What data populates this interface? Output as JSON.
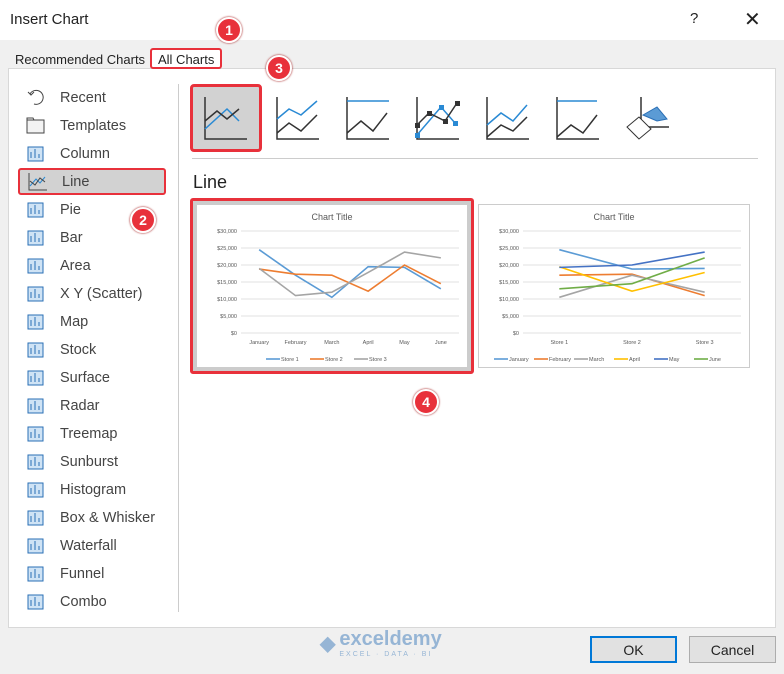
{
  "window": {
    "title": "Insert Chart",
    "help": "?",
    "close": "✕"
  },
  "tabs": [
    {
      "label": "Recommended Charts"
    },
    {
      "label": "All Charts",
      "selected": true
    }
  ],
  "sidebar": {
    "items": [
      {
        "label": "Recent",
        "icon": "recent-icon"
      },
      {
        "label": "Templates",
        "icon": "folder-icon"
      },
      {
        "label": "Column",
        "icon": "column-chart-icon"
      },
      {
        "label": "Line",
        "icon": "line-chart-icon",
        "selected": true
      },
      {
        "label": "Pie",
        "icon": "pie-chart-icon"
      },
      {
        "label": "Bar",
        "icon": "bar-chart-icon"
      },
      {
        "label": "Area",
        "icon": "area-chart-icon"
      },
      {
        "label": "X Y (Scatter)",
        "icon": "scatter-chart-icon"
      },
      {
        "label": "Map",
        "icon": "map-chart-icon"
      },
      {
        "label": "Stock",
        "icon": "stock-chart-icon"
      },
      {
        "label": "Surface",
        "icon": "surface-chart-icon"
      },
      {
        "label": "Radar",
        "icon": "radar-chart-icon"
      },
      {
        "label": "Treemap",
        "icon": "treemap-chart-icon"
      },
      {
        "label": "Sunburst",
        "icon": "sunburst-chart-icon"
      },
      {
        "label": "Histogram",
        "icon": "histogram-chart-icon"
      },
      {
        "label": "Box & Whisker",
        "icon": "box-whisker-chart-icon"
      },
      {
        "label": "Waterfall",
        "icon": "waterfall-chart-icon"
      },
      {
        "label": "Funnel",
        "icon": "funnel-chart-icon"
      },
      {
        "label": "Combo",
        "icon": "combo-chart-icon"
      }
    ]
  },
  "subtypes": [
    "Line",
    "Stacked Line",
    "100% Stacked Line",
    "Line with Markers",
    "Stacked Line with Markers",
    "100% Stacked Line with Markers",
    "3-D Line"
  ],
  "main": {
    "heading": "Line"
  },
  "colors": {
    "accent": "#e8313b",
    "series": [
      "#5b9bd5",
      "#ed7d31",
      "#a5a5a5",
      "#ffc000",
      "#4472c4",
      "#70ad47"
    ]
  },
  "chart_data": [
    {
      "type": "line",
      "title": "Chart Title",
      "categories": [
        "January",
        "February",
        "March",
        "April",
        "May",
        "June"
      ],
      "ylim": [
        0,
        30000
      ],
      "yticks": [
        "$0",
        "$5,000",
        "$10,000",
        "$15,000",
        "$20,000",
        "$25,000",
        "$30,000"
      ],
      "legend": "bottom",
      "grid": true,
      "series": [
        {
          "name": "Store 1",
          "values": [
            24500,
            17000,
            10500,
            19500,
            19300,
            13000
          ]
        },
        {
          "name": "Store 2",
          "values": [
            18800,
            17300,
            17000,
            12300,
            20000,
            14500
          ]
        },
        {
          "name": "Store 3",
          "values": [
            19000,
            11000,
            12000,
            17800,
            23800,
            22100
          ]
        }
      ]
    },
    {
      "type": "line",
      "title": "Chart Title",
      "categories": [
        "Store 1",
        "Store 2",
        "Store 3"
      ],
      "ylim": [
        0,
        30000
      ],
      "yticks": [
        "$0",
        "$5,000",
        "$10,000",
        "$15,000",
        "$20,000",
        "$25,000",
        "$30,000"
      ],
      "legend": "bottom",
      "grid": true,
      "series": [
        {
          "name": "January",
          "values": [
            24500,
            18800,
            19000
          ]
        },
        {
          "name": "February",
          "values": [
            17000,
            17300,
            11000
          ]
        },
        {
          "name": "March",
          "values": [
            10500,
            17000,
            12000
          ]
        },
        {
          "name": "April",
          "values": [
            19500,
            12300,
            17800
          ]
        },
        {
          "name": "May",
          "values": [
            19300,
            20000,
            23800
          ]
        },
        {
          "name": "June",
          "values": [
            13000,
            14500,
            22100
          ]
        }
      ]
    }
  ],
  "buttons": {
    "ok": "OK",
    "cancel": "Cancel"
  },
  "markers": [
    "1",
    "2",
    "3",
    "4"
  ],
  "watermark": {
    "name": "exceldemy",
    "tagline": "EXCEL · DATA · BI"
  }
}
